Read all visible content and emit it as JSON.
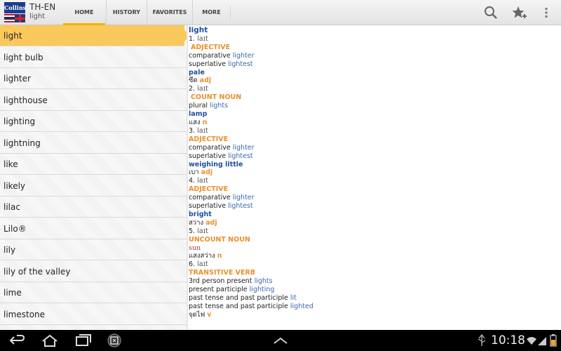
{
  "app": {
    "logo_text": "Collins",
    "title": "TH-EN",
    "subtitle": "light"
  },
  "tabs": [
    {
      "label": "HOME",
      "active": true
    },
    {
      "label": "HISTORY",
      "active": false
    },
    {
      "label": "FAVORITES",
      "active": false
    },
    {
      "label": "MORE",
      "active": false
    }
  ],
  "actions": {
    "search_icon": "search-icon",
    "favorite_add_icon": "star-plus-icon",
    "overflow_icon": "overflow-menu-icon"
  },
  "word_list": [
    {
      "word": "light",
      "selected": true
    },
    {
      "word": "light bulb",
      "selected": false
    },
    {
      "word": "lighter",
      "selected": false
    },
    {
      "word": "lighthouse",
      "selected": false
    },
    {
      "word": "lighting",
      "selected": false
    },
    {
      "word": "lightning",
      "selected": false
    },
    {
      "word": "like",
      "selected": false
    },
    {
      "word": "likely",
      "selected": false
    },
    {
      "word": "lilac",
      "selected": false
    },
    {
      "word": "Lilo®",
      "selected": false
    },
    {
      "word": "lily",
      "selected": false
    },
    {
      "word": "lily of the valley",
      "selected": false
    },
    {
      "word": "lime",
      "selected": false
    },
    {
      "word": "limestone",
      "selected": false
    }
  ],
  "entry": {
    "headword": "light",
    "senses": {
      "s1_num": "1.",
      "s1_phon": "laɪt",
      "s1_pos": "ADJECTIVE",
      "s1_comp_label": "comparative",
      "s1_comp": "lighter",
      "s1_sup_label": "superlative",
      "s1_sup": "lightest",
      "s1_trans": "pale",
      "s1_thai": "ซีด",
      "s1_thai_pos": "adj",
      "s2_num": "2.",
      "s2_phon": "laɪt",
      "s2_pos": "COUNT NOUN",
      "s2_plural_label": "plural",
      "s2_plural": "lights",
      "s2_trans": "lamp",
      "s2_thai": "แสง",
      "s2_thai_pos": "n",
      "s3_num": "3.",
      "s3_phon": "laɪt",
      "s3_pos": "ADJECTIVE",
      "s3_comp_label": "comparative",
      "s3_comp": "lighter",
      "s3_sup_label": "superlative",
      "s3_sup": "lightest",
      "s3_trans": "weighing little",
      "s3_thai": "เบา",
      "s3_thai_pos": "adj",
      "s4_num": "4.",
      "s4_phon": "laɪt",
      "s4_pos": "ADJECTIVE",
      "s4_comp_label": "comparative",
      "s4_comp": "lighter",
      "s4_sup_label": "superlative",
      "s4_sup": "lightest",
      "s4_trans": "bright",
      "s4_thai": "สว่าง",
      "s4_thai_pos": "adj",
      "s5_num": "5.",
      "s5_phon": "laɪt",
      "s5_pos": "UNCOUNT NOUN",
      "s5_trans": "sun",
      "s5_thai": "แสงสว่าง",
      "s5_thai_pos": "n",
      "s6_num": "6.",
      "s6_phon": "laɪt",
      "s6_pos": "TRANSITIVE VERB",
      "s6_3rd_label": "3rd person present",
      "s6_3rd": "lights",
      "s6_pp_label": "present participle",
      "s6_pp": "lighting",
      "s6_past1_label": "past tense and past participle",
      "s6_past1": "lit",
      "s6_past2_label": "past tense and past participle",
      "s6_past2": "lighted",
      "s6_thai": "จุดไฟ",
      "s6_thai_pos": "v"
    }
  },
  "statusbar": {
    "time": "10:18"
  },
  "colors": {
    "accent": "#f3b400",
    "selected_row": "#fbc85c",
    "headword": "#1e4f9a",
    "pos": "#e8902c",
    "link": "#3b68b0"
  }
}
